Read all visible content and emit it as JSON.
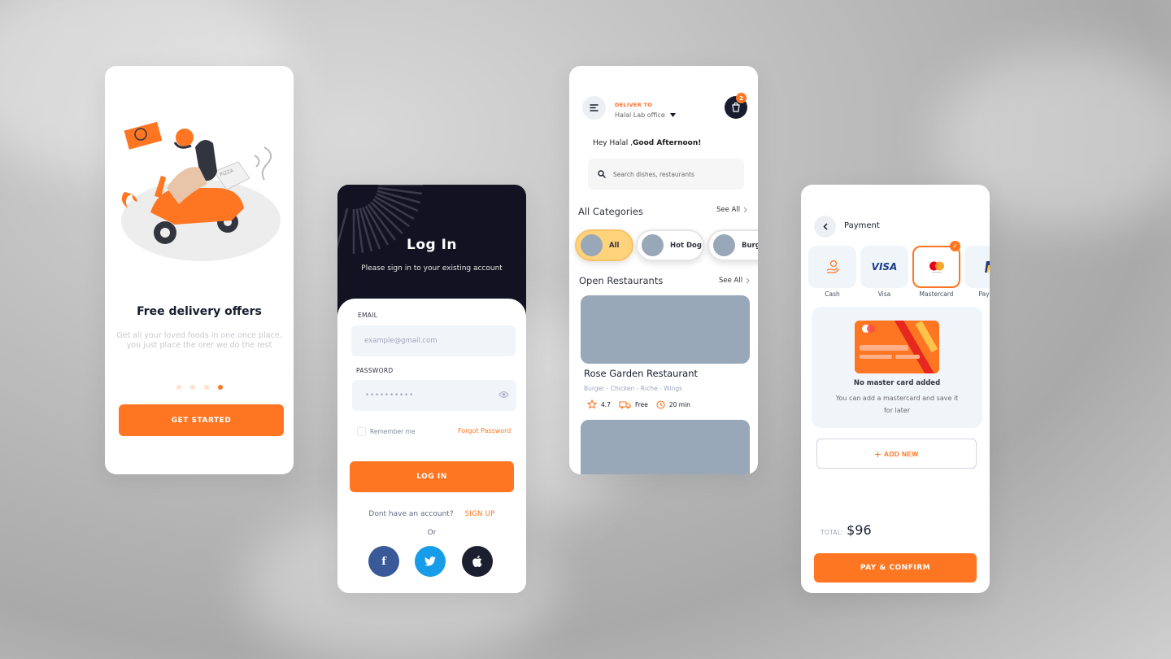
{
  "onboarding": {
    "title": "Free delivery offers",
    "description": "Get all your loved foods in one once place, you just place the orer we do the rest",
    "button": "GET STARTED",
    "illustration_text": "PIZZA"
  },
  "login": {
    "title": "Log In",
    "subtitle": "Please sign in to your existing account",
    "email_label": "EMAIL",
    "email_placeholder": "example@gmail.com",
    "password_label": "PASSWORD",
    "password_value": "••••••••••",
    "remember": "Remember me",
    "forgot": "Forgot Password",
    "button": "LOG IN",
    "no_account": "Dont have an account?",
    "signup": "SIGN UP",
    "or": "Or",
    "social_icons": [
      "facebook-icon",
      "twitter-icon",
      "apple-icon"
    ],
    "social_colors": [
      "#395998",
      "#169ce8",
      "#1b1f2f"
    ]
  },
  "home": {
    "deliver_to": "DELIVER TO",
    "location": "Halal Lab office",
    "cart_count": "2",
    "greeting_prefix": "Hey Halal ,",
    "greeting_bold": "Good Afternoon!",
    "search_placeholder": "Search dishes, restaurants",
    "categories_title": "All Categories",
    "see_all": "See All",
    "categories": [
      "All",
      "Hot Dog",
      "Burger"
    ],
    "open_title": "Open Restaurants",
    "restaurant": {
      "name": "Rose Garden Restaurant",
      "tags": "Burger - Chicken - Riche - Wings",
      "rating": "4.7",
      "delivery": "Free",
      "time": "20 min"
    }
  },
  "payment": {
    "title": "Payment",
    "methods": [
      "Cash",
      "Visa",
      "Mastercard",
      "PayPal"
    ],
    "visa_logo": "VISA",
    "selected": "Mastercard",
    "empty_title": "No master card added",
    "empty_desc": "You can add a mastercard and save it for later",
    "add_new": "ADD NEW",
    "total_label": "TOTAL:",
    "total_value": "$96",
    "button": "PAY & CONFIRM"
  },
  "colors": {
    "accent": "#fe7622",
    "dark": "#121223",
    "placeholder": "#98a8b8"
  }
}
